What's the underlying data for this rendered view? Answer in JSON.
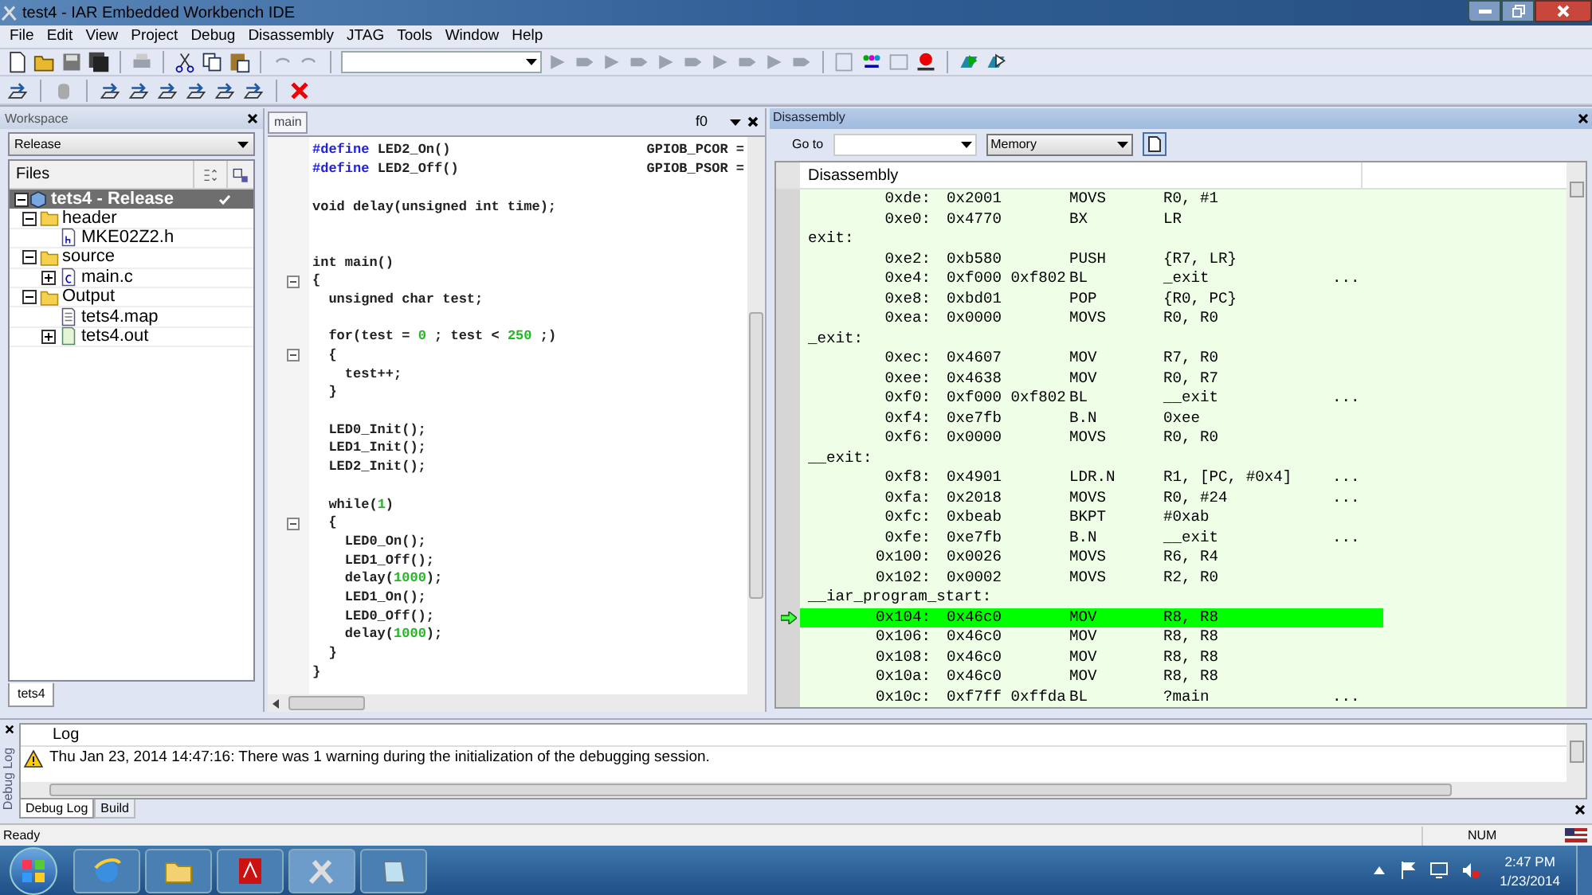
{
  "window": {
    "title": "test4 - IAR Embedded Workbench IDE"
  },
  "menu": [
    "File",
    "Edit",
    "View",
    "Project",
    "Debug",
    "Disassembly",
    "JTAG",
    "Tools",
    "Window",
    "Help"
  ],
  "workspace": {
    "title": "Workspace",
    "configuration": "Release",
    "files_header": "Files",
    "tab": "tets4",
    "project": {
      "name": "tets4 - Release",
      "selected": true,
      "checked": true,
      "expanded": true,
      "children": [
        {
          "name": "header",
          "kind": "folder",
          "expanded": true,
          "children": [
            {
              "name": "MKE02Z2.h",
              "kind": "header"
            }
          ]
        },
        {
          "name": "source",
          "kind": "folder",
          "expanded": true,
          "children": [
            {
              "name": "main.c",
              "kind": "source",
              "expanded": false
            }
          ]
        },
        {
          "name": "Output",
          "kind": "folder",
          "expanded": true,
          "children": [
            {
              "name": "tets4.map",
              "kind": "map"
            },
            {
              "name": "tets4.out",
              "kind": "output",
              "expanded": false
            }
          ]
        }
      ]
    }
  },
  "editor": {
    "tab": "main",
    "function": "f0",
    "lines": [
      {
        "fold": false,
        "segments": [
          {
            "text": "#define",
            "kind": "pp"
          },
          {
            "text": " LED2_On()",
            "kind": "plain"
          }
        ],
        "right": "GPIOB_PCOR ="
      },
      {
        "fold": false,
        "segments": [
          {
            "text": "#define",
            "kind": "pp"
          },
          {
            "text": " LED2_Off()",
            "kind": "plain"
          }
        ],
        "right": "GPIOB_PSOR ="
      },
      {
        "fold": false
      },
      {
        "fold": false,
        "segments": [
          {
            "text": "void delay(unsigned int time);",
            "kind": "plain"
          }
        ]
      },
      {
        "fold": false
      },
      {
        "fold": false
      },
      {
        "fold": false,
        "segments": [
          {
            "text": "int main()",
            "kind": "plain"
          }
        ]
      },
      {
        "fold": true,
        "segments": [
          {
            "text": "{",
            "kind": "plain"
          }
        ]
      },
      {
        "fold": false,
        "segments": [
          {
            "text": "  unsigned char test;",
            "kind": "plain"
          }
        ]
      },
      {
        "fold": false
      },
      {
        "fold": false,
        "segments": [
          {
            "text": "  for(test = ",
            "kind": "plain"
          },
          {
            "text": "0",
            "kind": "num"
          },
          {
            "text": " ; test < ",
            "kind": "plain"
          },
          {
            "text": "250",
            "kind": "num"
          },
          {
            "text": " ;)",
            "kind": "plain"
          }
        ]
      },
      {
        "fold": true,
        "segments": [
          {
            "text": "  {",
            "kind": "plain"
          }
        ]
      },
      {
        "fold": false,
        "segments": [
          {
            "text": "    test++;",
            "kind": "plain"
          }
        ]
      },
      {
        "fold": false,
        "segments": [
          {
            "text": "  }",
            "kind": "plain"
          }
        ]
      },
      {
        "fold": false
      },
      {
        "fold": false,
        "segments": [
          {
            "text": "  LED0_Init();",
            "kind": "plain"
          }
        ]
      },
      {
        "fold": false,
        "segments": [
          {
            "text": "  LED1_Init();",
            "kind": "plain"
          }
        ]
      },
      {
        "fold": false,
        "segments": [
          {
            "text": "  LED2_Init();",
            "kind": "plain"
          }
        ]
      },
      {
        "fold": false
      },
      {
        "fold": false,
        "segments": [
          {
            "text": "  while(",
            "kind": "plain"
          },
          {
            "text": "1",
            "kind": "num"
          },
          {
            "text": ")",
            "kind": "plain"
          }
        ]
      },
      {
        "fold": true,
        "segments": [
          {
            "text": "  {",
            "kind": "plain"
          }
        ]
      },
      {
        "fold": false,
        "segments": [
          {
            "text": "    LED0_On();",
            "kind": "plain"
          }
        ]
      },
      {
        "fold": false,
        "segments": [
          {
            "text": "    LED1_Off();",
            "kind": "plain"
          }
        ]
      },
      {
        "fold": false,
        "segments": [
          {
            "text": "    delay(",
            "kind": "plain"
          },
          {
            "text": "1000",
            "kind": "num"
          },
          {
            "text": ");",
            "kind": "plain"
          }
        ]
      },
      {
        "fold": false,
        "segments": [
          {
            "text": "    LED1_On();",
            "kind": "plain"
          }
        ]
      },
      {
        "fold": false,
        "segments": [
          {
            "text": "    LED0_Off();",
            "kind": "plain"
          }
        ]
      },
      {
        "fold": false,
        "segments": [
          {
            "text": "    delay(",
            "kind": "plain"
          },
          {
            "text": "1000",
            "kind": "num"
          },
          {
            "text": ");",
            "kind": "plain"
          }
        ]
      },
      {
        "fold": false,
        "segments": [
          {
            "text": "  }",
            "kind": "plain"
          }
        ]
      },
      {
        "fold": false,
        "segments": [
          {
            "text": "}",
            "kind": "plain"
          }
        ]
      }
    ]
  },
  "disassembly": {
    "title": "Disassembly",
    "goto_label": "Go to",
    "memory": "Memory",
    "heading": "Disassembly",
    "rows": [
      {
        "kind": "instr",
        "current": false,
        "address": "0xde:",
        "code": "0x2001",
        "mnemonic": "MOVS",
        "operands": "R0, #1"
      },
      {
        "kind": "instr",
        "current": false,
        "address": "0xe0:",
        "code": "0x4770",
        "mnemonic": "BX",
        "operands": "LR"
      },
      {
        "kind": "label",
        "text": "exit:"
      },
      {
        "kind": "instr",
        "current": false,
        "address": "0xe2:",
        "code": "0xb580",
        "mnemonic": "PUSH",
        "operands": "{R7, LR}"
      },
      {
        "kind": "instr",
        "current": false,
        "address": "0xe4:",
        "code": "0xf000 0xf802",
        "mnemonic": "BL",
        "operands": "_exit",
        "more": "..."
      },
      {
        "kind": "instr",
        "current": false,
        "address": "0xe8:",
        "code": "0xbd01",
        "mnemonic": "POP",
        "operands": "{R0, PC}"
      },
      {
        "kind": "instr",
        "current": false,
        "address": "0xea:",
        "code": "0x0000",
        "mnemonic": "MOVS",
        "operands": "R0, R0"
      },
      {
        "kind": "label",
        "text": "_exit:"
      },
      {
        "kind": "instr",
        "current": false,
        "address": "0xec:",
        "code": "0x4607",
        "mnemonic": "MOV",
        "operands": "R7, R0"
      },
      {
        "kind": "instr",
        "current": false,
        "address": "0xee:",
        "code": "0x4638",
        "mnemonic": "MOV",
        "operands": "R0, R7"
      },
      {
        "kind": "instr",
        "current": false,
        "address": "0xf0:",
        "code": "0xf000 0xf802",
        "mnemonic": "BL",
        "operands": "__exit",
        "more": "..."
      },
      {
        "kind": "instr",
        "current": false,
        "address": "0xf4:",
        "code": "0xe7fb",
        "mnemonic": "B.N",
        "operands": "0xee"
      },
      {
        "kind": "instr",
        "current": false,
        "address": "0xf6:",
        "code": "0x0000",
        "mnemonic": "MOVS",
        "operands": "R0, R0"
      },
      {
        "kind": "label",
        "text": "__exit:"
      },
      {
        "kind": "instr",
        "current": false,
        "address": "0xf8:",
        "code": "0x4901",
        "mnemonic": "LDR.N",
        "operands": "R1, [PC, #0x4]",
        "more": "..."
      },
      {
        "kind": "instr",
        "current": false,
        "address": "0xfa:",
        "code": "0x2018",
        "mnemonic": "MOVS",
        "operands": "R0, #24",
        "more": "..."
      },
      {
        "kind": "instr",
        "current": false,
        "address": "0xfc:",
        "code": "0xbeab",
        "mnemonic": "BKPT",
        "operands": "#0xab"
      },
      {
        "kind": "instr",
        "current": false,
        "address": "0xfe:",
        "code": "0xe7fb",
        "mnemonic": "B.N",
        "operands": "__exit",
        "more": "..."
      },
      {
        "kind": "instr",
        "current": false,
        "address": "0x100:",
        "code": "0x0026",
        "mnemonic": "MOVS",
        "operands": "R6, R4"
      },
      {
        "kind": "instr",
        "current": false,
        "address": "0x102:",
        "code": "0x0002",
        "mnemonic": "MOVS",
        "operands": "R2, R0"
      },
      {
        "kind": "label",
        "text": "__iar_program_start:"
      },
      {
        "kind": "instr",
        "current": true,
        "address": "0x104:",
        "code": "0x46c0",
        "mnemonic": "MOV",
        "operands": "R8, R8"
      },
      {
        "kind": "instr",
        "current": false,
        "address": "0x106:",
        "code": "0x46c0",
        "mnemonic": "MOV",
        "operands": "R8, R8"
      },
      {
        "kind": "instr",
        "current": false,
        "address": "0x108:",
        "code": "0x46c0",
        "mnemonic": "MOV",
        "operands": "R8, R8"
      },
      {
        "kind": "instr",
        "current": false,
        "address": "0x10a:",
        "code": "0x46c0",
        "mnemonic": "MOV",
        "operands": "R8, R8"
      },
      {
        "kind": "instr",
        "current": false,
        "address": "0x10c:",
        "code": "0xf7ff 0xffda",
        "mnemonic": "BL",
        "operands": "?main",
        "more": "..."
      }
    ]
  },
  "log": {
    "side_title": "Debug Log",
    "heading": "Log",
    "entries": [
      {
        "kind": "warning",
        "text": "Thu Jan 23, 2014 14:47:16: There was 1 warning during the initialization of the debugging session."
      }
    ],
    "tabs": [
      {
        "label": "Debug Log",
        "selected": true
      },
      {
        "label": "Build",
        "selected": false
      }
    ]
  },
  "status_bar": {
    "message": "Ready",
    "indicator": "NUM"
  },
  "taskbar": {
    "time": "2:47 PM",
    "date": "1/23/2014"
  }
}
